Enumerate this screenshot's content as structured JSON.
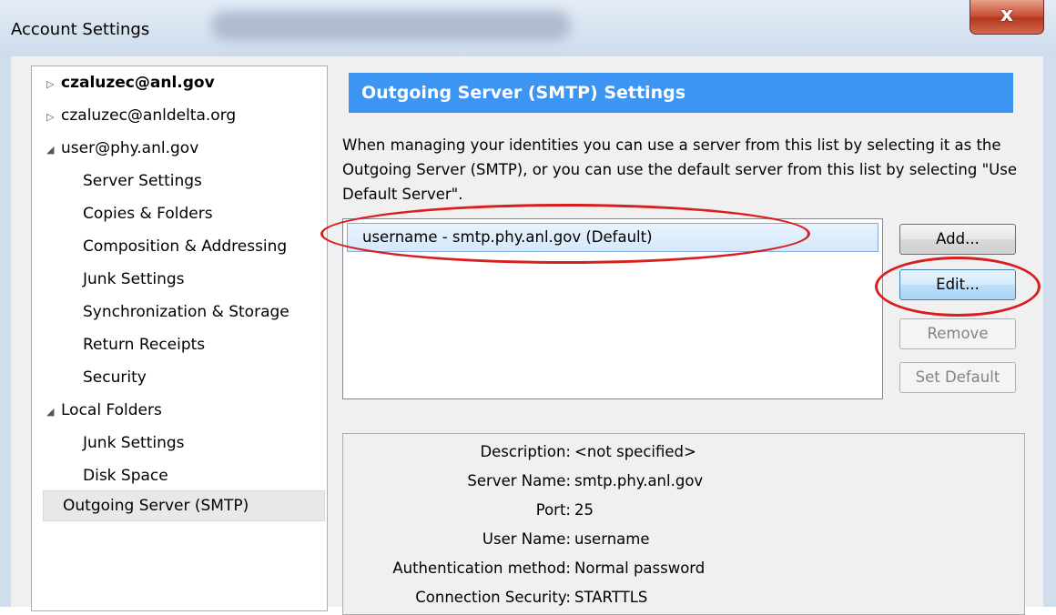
{
  "window": {
    "title": "Account Settings",
    "close_glyph": "x"
  },
  "tree": {
    "items": [
      {
        "label": "czaluzec@anl.gov",
        "arrow": "▷"
      },
      {
        "label": "czaluzec@anldelta.org",
        "arrow": "▷"
      },
      {
        "label": "user@phy.anl.gov",
        "arrow": "◢"
      },
      {
        "label": "Server Settings"
      },
      {
        "label": "Copies & Folders"
      },
      {
        "label": "Composition & Addressing"
      },
      {
        "label": "Junk Settings"
      },
      {
        "label": "Synchronization & Storage"
      },
      {
        "label": "Return Receipts"
      },
      {
        "label": "Security"
      },
      {
        "label": "Local Folders",
        "arrow": "◢"
      },
      {
        "label": "Junk Settings"
      },
      {
        "label": "Disk Space"
      },
      {
        "label": "Outgoing Server (SMTP)"
      }
    ]
  },
  "panel": {
    "header": "Outgoing Server (SMTP) Settings",
    "description": "When managing your identities you can use a server from this list by selecting it as the Outgoing Server (SMTP), or you can use the default server from this list by selecting \"Use Default Server\".",
    "server_item": "username - smtp.phy.anl.gov (Default)",
    "buttons": {
      "add": "Add...",
      "edit": "Edit...",
      "remove": "Remove",
      "set_default": "Set Default"
    },
    "details": [
      {
        "label": "Description:",
        "value": "<not specified>"
      },
      {
        "label": "Server Name:",
        "value": "smtp.phy.anl.gov"
      },
      {
        "label": "Port:",
        "value": "25"
      },
      {
        "label": "User Name:",
        "value": "username"
      },
      {
        "label": "Authentication method:",
        "value": "Normal password"
      },
      {
        "label": "Connection Security:",
        "value": "STARTTLS"
      }
    ]
  },
  "colors": {
    "header_bg": "#3c94f3",
    "annotation": "#d81f1f"
  }
}
